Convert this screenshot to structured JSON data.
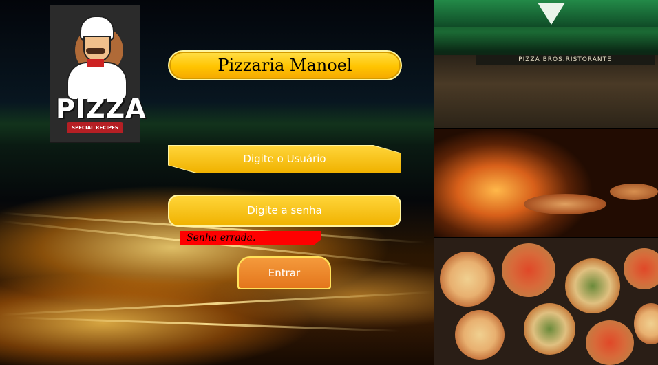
{
  "app": {
    "logo_word": "PIZZA",
    "logo_ribbon": "SPECIAL RECIPES",
    "title": "Pizzaria Manoel"
  },
  "form": {
    "user_label": "Digite o Usuário",
    "password_label": "Digite a senha",
    "error_message": "Senha errada.",
    "submit_label": "Entrar"
  },
  "photos": {
    "restaurant_sign": "PIZZA BROS.RISTORANTE"
  },
  "colors": {
    "accent_yellow": "#ffc400",
    "button_orange": "#e4761c",
    "error_red": "#ff0000"
  }
}
